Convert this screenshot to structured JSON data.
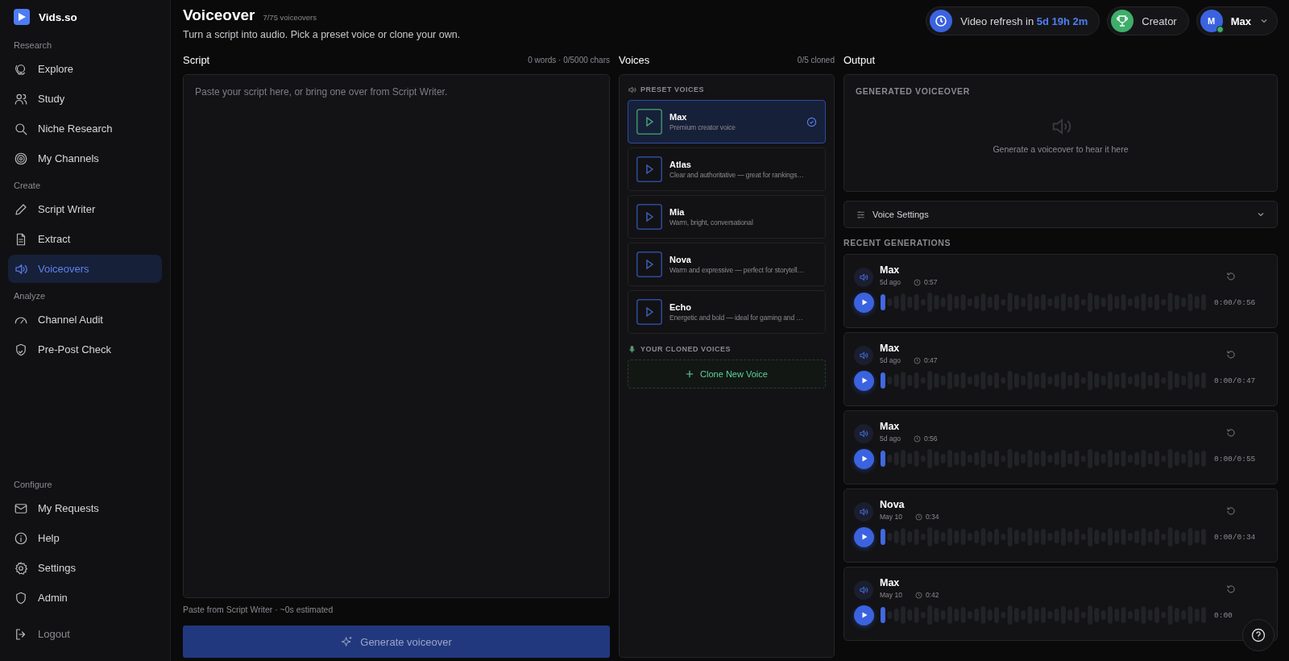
{
  "brand": {
    "name": "Vids.so"
  },
  "sidebar": {
    "sections": [
      {
        "label": "Research",
        "items": [
          {
            "label": "Explore",
            "selected": false
          },
          {
            "label": "Study",
            "selected": false
          },
          {
            "label": "Niche Research",
            "selected": false
          },
          {
            "label": "My Channels",
            "selected": false
          }
        ]
      },
      {
        "label": "Create",
        "items": [
          {
            "label": "Script Writer",
            "selected": false
          },
          {
            "label": "Extract",
            "selected": false
          },
          {
            "label": "Voiceovers",
            "selected": true
          }
        ]
      },
      {
        "label": "Analyze",
        "items": [
          {
            "label": "Channel Audit",
            "selected": false
          },
          {
            "label": "Pre-Post Check",
            "selected": false
          }
        ]
      },
      {
        "label": "Configure",
        "items": [
          {
            "label": "My Requests",
            "selected": false
          },
          {
            "label": "Help",
            "selected": false
          },
          {
            "label": "Settings",
            "selected": false
          },
          {
            "label": "Admin",
            "selected": false
          }
        ]
      }
    ],
    "logout": "Logout"
  },
  "header": {
    "title": "Voiceover",
    "count": "7/75 voiceovers",
    "subtitle": "Turn a script into audio. Pick a preset voice or clone your own.",
    "refresh": {
      "label": "Video refresh in",
      "value": "5d 19h 2m"
    },
    "plan": "Creator",
    "user": {
      "initial": "M",
      "name": "Max",
      "online": true
    }
  },
  "script": {
    "title": "Script",
    "stats": "0 words · 0/5000 chars",
    "placeholder": "Paste your script here, or bring one over from Script Writer.",
    "hint": "Paste from Script Writer · ~0s estimated",
    "button": "Generate voiceover"
  },
  "voices": {
    "title": "Voices",
    "stats": "0/5 cloned",
    "preset_title": "PRESET VOICES",
    "presets": [
      {
        "name": "Max",
        "description": "Premium creator voice",
        "selected": true
      },
      {
        "name": "Atlas",
        "description": "Clear and authoritative — great for rankings…",
        "selected": false
      },
      {
        "name": "Mia",
        "description": "Warm, bright, conversational",
        "selected": false
      },
      {
        "name": "Nova",
        "description": "Warm and expressive — perfect for storytell…",
        "selected": false
      },
      {
        "name": "Echo",
        "description": "Energetic and bold — ideal for gaming and …",
        "selected": false
      }
    ],
    "cloned_title": "YOUR CLONED VOICES",
    "clone_button": "Clone New Voice"
  },
  "output": {
    "title": "Output",
    "generated_title": "GENERATED VOICEOVER",
    "empty_text": "Generate a voiceover to hear it here",
    "settings": "Voice Settings",
    "recent_title": "RECENT GENERATIONS",
    "generations": [
      {
        "voice": "Max",
        "date": "5d ago",
        "duration": "0:57",
        "time": "0:00/0:56"
      },
      {
        "voice": "Max",
        "date": "5d ago",
        "duration": "0:47",
        "time": "0:00/0:47"
      },
      {
        "voice": "Max",
        "date": "5d ago",
        "duration": "0:56",
        "time": "0:00/0:55"
      },
      {
        "voice": "Nova",
        "date": "May 10",
        "duration": "0:34",
        "time": "0:00/0:34"
      },
      {
        "voice": "Max",
        "date": "May 10",
        "duration": "0:42",
        "time": "0:00"
      }
    ]
  }
}
